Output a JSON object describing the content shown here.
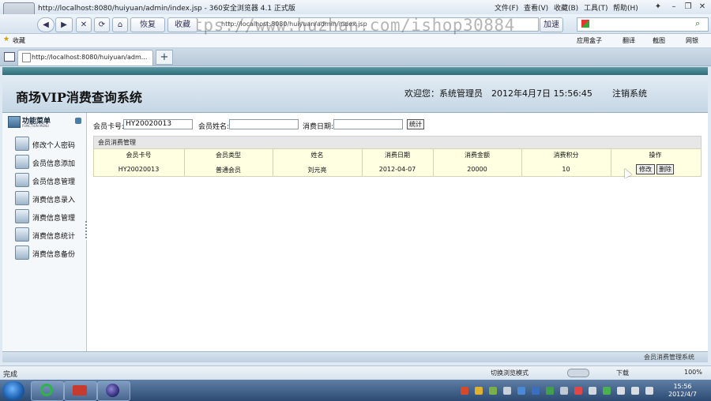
{
  "browser": {
    "title": "http://localhost:8080/huiyuan/admin/index.jsp - 360安全浏览器 4.1 正式版",
    "menu": [
      "文件(F)",
      "查看(V)",
      "收藏(B)",
      "工具(T)",
      "帮助(H)"
    ],
    "nav": {
      "back": "◀",
      "forward": "▶",
      "stop": "✕",
      "refresh": "⟳",
      "home": "⌂",
      "recover": "恢复",
      "favorites": "收藏",
      "accel": "加速"
    },
    "address": "http://localhost:8080/huiyuan/admin/index.jsp",
    "favorites_label": "收藏",
    "favbar_right": [
      "应用盒子",
      "翻译",
      "截图",
      "网银"
    ],
    "tab_title": "http://localhost:8080/huiyuan/adm...",
    "new_tab": "+",
    "status": "完成",
    "status_right": [
      "切换浏览模式",
      "下载",
      "100%"
    ]
  },
  "watermark": "https://www.huzhan.com/ishop30884",
  "app": {
    "title": "商场VIP消费查询系统",
    "welcome": "欢迎您：系统管理员　2012年4月7日  15:56:45",
    "logout": "注销系统",
    "footer": "会员消费管理系统",
    "sidebar": {
      "heading": "功能菜单",
      "subheading": "FUNCTION MENU",
      "items": [
        {
          "label": "修改个人密码"
        },
        {
          "label": "会员信息添加"
        },
        {
          "label": "会员信息管理"
        },
        {
          "label": "消费信息录入"
        },
        {
          "label": "消费信息管理"
        },
        {
          "label": "消费信息统计"
        },
        {
          "label": "消费信息备份"
        }
      ]
    },
    "filters": {
      "card_label": "会员卡号:",
      "card_value": "HY20020013",
      "name_label": "会员姓名:",
      "name_value": "",
      "date_label": "消费日期:",
      "date_value": "",
      "stat_button": "统计"
    },
    "panel_title": "会员消费管理",
    "table": {
      "headers": [
        "会员卡号",
        "会员类型",
        "姓名",
        "消费日期",
        "消费金额",
        "消费积分",
        "操作"
      ],
      "rows": [
        {
          "card": "HY20020013",
          "type": "普通会员",
          "name": "刘元亮",
          "date": "2012-04-07",
          "amount": "20000",
          "points": "10",
          "edit": "修改",
          "delete": "删除"
        }
      ]
    }
  },
  "taskbar": {
    "clock_time": "15:56",
    "clock_date": "2012/4/7"
  }
}
